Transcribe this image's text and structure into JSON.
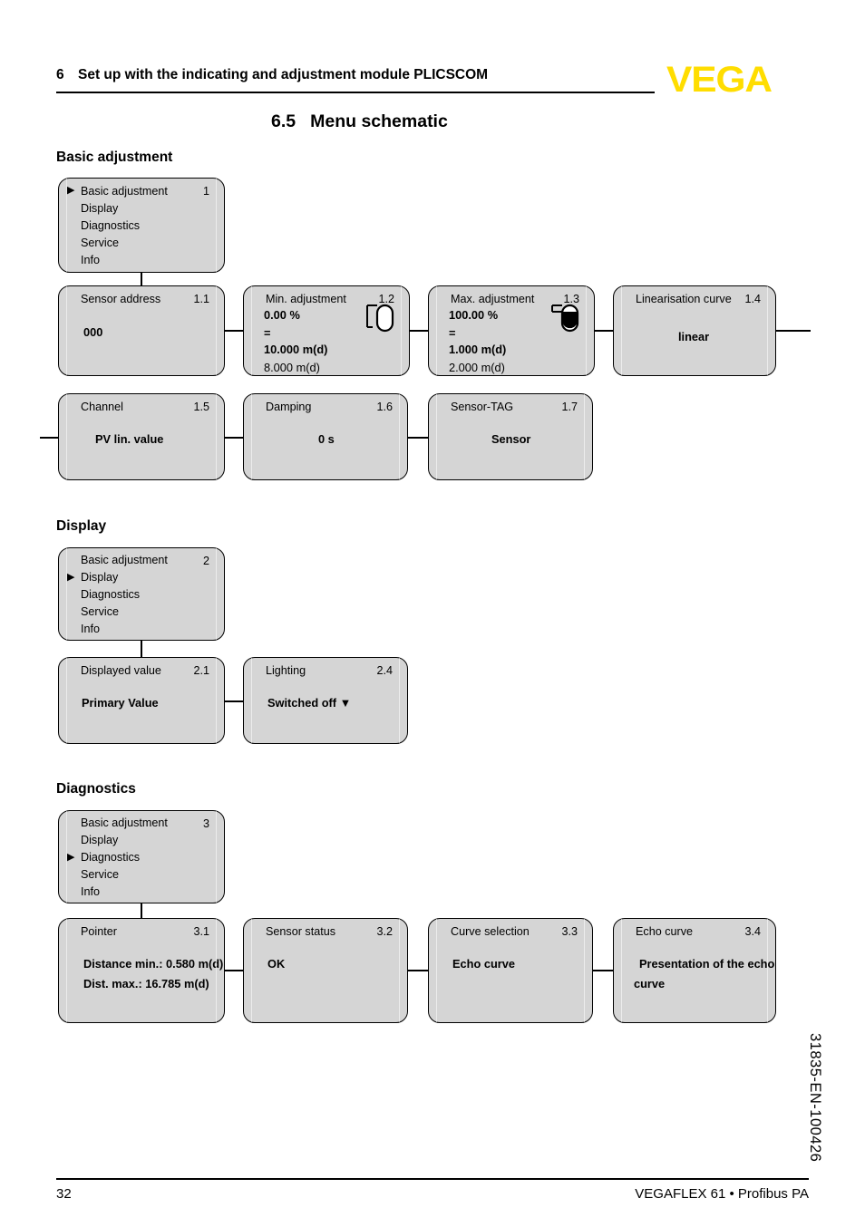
{
  "header": {
    "chapter_number": "6",
    "chapter_title": "Set up with the indicating and adjustment module PLICSCOM",
    "logo": "VEGA"
  },
  "section": {
    "number": "6.5",
    "title": "Menu schematic"
  },
  "groups": {
    "basic_adjustment": "Basic adjustment",
    "display": "Display",
    "diagnostics": "Diagnostics"
  },
  "menu_items": [
    "Basic adjustment",
    "Display",
    "Diagnostics",
    "Service",
    "Info"
  ],
  "menus": {
    "basic": {
      "id": "1",
      "selected": "Basic adjustment"
    },
    "display": {
      "id": "2",
      "selected": "Display"
    },
    "diagnostics": {
      "id": "3",
      "selected": "Diagnostics"
    }
  },
  "boxes": {
    "b11": {
      "title": "Sensor address",
      "id": "1.1",
      "value": "000"
    },
    "b12": {
      "title": "Min. adjustment",
      "id": "1.2",
      "percent": "0.00 %",
      "equals": "=",
      "distance": "10.000 m(d)",
      "current": "8.000 m(d)",
      "icon": "vessel-min-icon"
    },
    "b13": {
      "title": "Max. adjustment",
      "id": "1.3",
      "percent": "100.00 %",
      "equals": "=",
      "distance": "1.000 m(d)",
      "current": "2.000 m(d)",
      "icon": "vessel-max-icon"
    },
    "b14": {
      "title": "Linearisation curve",
      "id": "1.4",
      "value": "linear"
    },
    "b15": {
      "title": "Channel",
      "id": "1.5",
      "value": "PV lin. value"
    },
    "b16": {
      "title": "Damping",
      "id": "1.6",
      "value": "0 s"
    },
    "b17": {
      "title": "Sensor-TAG",
      "id": "1.7",
      "value": "Sensor"
    },
    "b21": {
      "title": "Displayed value",
      "id": "2.1",
      "value": "Primary Value"
    },
    "b24": {
      "title": "Lighting",
      "id": "2.4",
      "value": "Switched off ▼"
    },
    "b31": {
      "title": "Pointer",
      "id": "3.1",
      "line1": "Distance min.: 0.580 m(d)",
      "line2": "Dist. max.: 16.785 m(d)"
    },
    "b32": {
      "title": "Sensor status",
      "id": "3.2",
      "value": "OK"
    },
    "b33": {
      "title": "Curve selection",
      "id": "3.3",
      "value": "Echo curve"
    },
    "b34": {
      "title": "Echo curve",
      "id": "3.4",
      "line1": "Presentation of the echo",
      "line2": "curve"
    }
  },
  "footer": {
    "page": "32",
    "product": "VEGAFLEX 61 • Profibus PA",
    "document_number": "31835-EN-100426"
  },
  "colors": {
    "brand_yellow": "#FFDD00",
    "box_fill": "#d5d5d5",
    "line": "#000000"
  }
}
